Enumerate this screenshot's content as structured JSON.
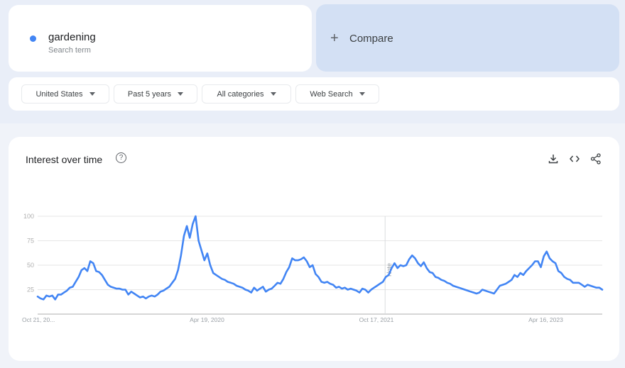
{
  "search_term": {
    "name": "gardening",
    "subtitle": "Search term",
    "color": "#4285f4"
  },
  "compare": {
    "label": "Compare",
    "icon": "plus-icon"
  },
  "filters": [
    {
      "label": "United States",
      "icon": "caret-down-icon"
    },
    {
      "label": "Past 5 years",
      "icon": "caret-down-icon"
    },
    {
      "label": "All categories",
      "icon": "caret-down-icon"
    },
    {
      "label": "Web Search",
      "icon": "caret-down-icon"
    }
  ],
  "chart_card": {
    "title": "Interest over time",
    "help_icon": "help-circle-icon",
    "actions": [
      {
        "name": "download",
        "icon": "download-icon"
      },
      {
        "name": "embed",
        "icon": "code-icon"
      },
      {
        "name": "share",
        "icon": "share-icon"
      }
    ]
  },
  "chart_data": {
    "type": "line",
    "title": "Interest over time",
    "xlabel": "",
    "ylabel": "",
    "ylim": [
      0,
      100
    ],
    "yticks": [
      25,
      50,
      75,
      100
    ],
    "xtick_labels": [
      {
        "label": "Oct 21, 20...",
        "index": 0
      },
      {
        "label": "Apr 19, 2020",
        "index": 39
      },
      {
        "label": "Oct 17, 2021",
        "index": 78
      },
      {
        "label": "Apr 16, 2023",
        "index": 117
      }
    ],
    "annotation": {
      "label": "Note",
      "index": 80
    },
    "grid": true,
    "legend": "none",
    "series": [
      {
        "name": "gardening",
        "color": "#4285f4",
        "values": [
          18,
          16,
          15,
          19,
          18,
          19,
          15,
          20,
          20,
          22,
          24,
          27,
          28,
          33,
          38,
          45,
          47,
          44,
          54,
          52,
          44,
          43,
          40,
          35,
          30,
          28,
          27,
          26,
          26,
          25,
          25,
          20,
          23,
          21,
          19,
          17,
          18,
          16,
          18,
          19,
          18,
          20,
          23,
          24,
          26,
          28,
          32,
          36,
          45,
          60,
          80,
          90,
          78,
          92,
          100,
          75,
          65,
          55,
          62,
          50,
          42,
          40,
          38,
          36,
          35,
          33,
          32,
          31,
          29,
          28,
          27,
          25,
          24,
          22,
          27,
          24,
          26,
          28,
          23,
          25,
          26,
          29,
          32,
          31,
          36,
          43,
          48,
          57,
          55,
          55,
          56,
          58,
          54,
          48,
          50,
          41,
          38,
          33,
          32,
          33,
          31,
          30,
          27,
          28,
          26,
          27,
          25,
          26,
          25,
          24,
          22,
          26,
          25,
          22,
          25,
          27,
          29,
          31,
          33,
          38,
          40,
          47,
          52,
          47,
          50,
          49,
          50,
          56,
          60,
          57,
          52,
          49,
          53,
          47,
          43,
          42,
          38,
          37,
          35,
          34,
          32,
          31,
          29,
          28,
          27,
          26,
          25,
          24,
          23,
          22,
          21,
          22,
          25,
          24,
          23,
          22,
          21,
          25,
          29,
          30,
          31,
          33,
          35,
          40,
          38,
          42,
          40,
          44,
          47,
          50,
          54,
          54,
          48,
          59,
          64,
          57,
          54,
          52,
          44,
          42,
          38,
          36,
          35,
          32,
          32,
          32,
          30,
          28,
          30,
          29,
          28,
          27,
          27,
          25
        ]
      }
    ]
  }
}
